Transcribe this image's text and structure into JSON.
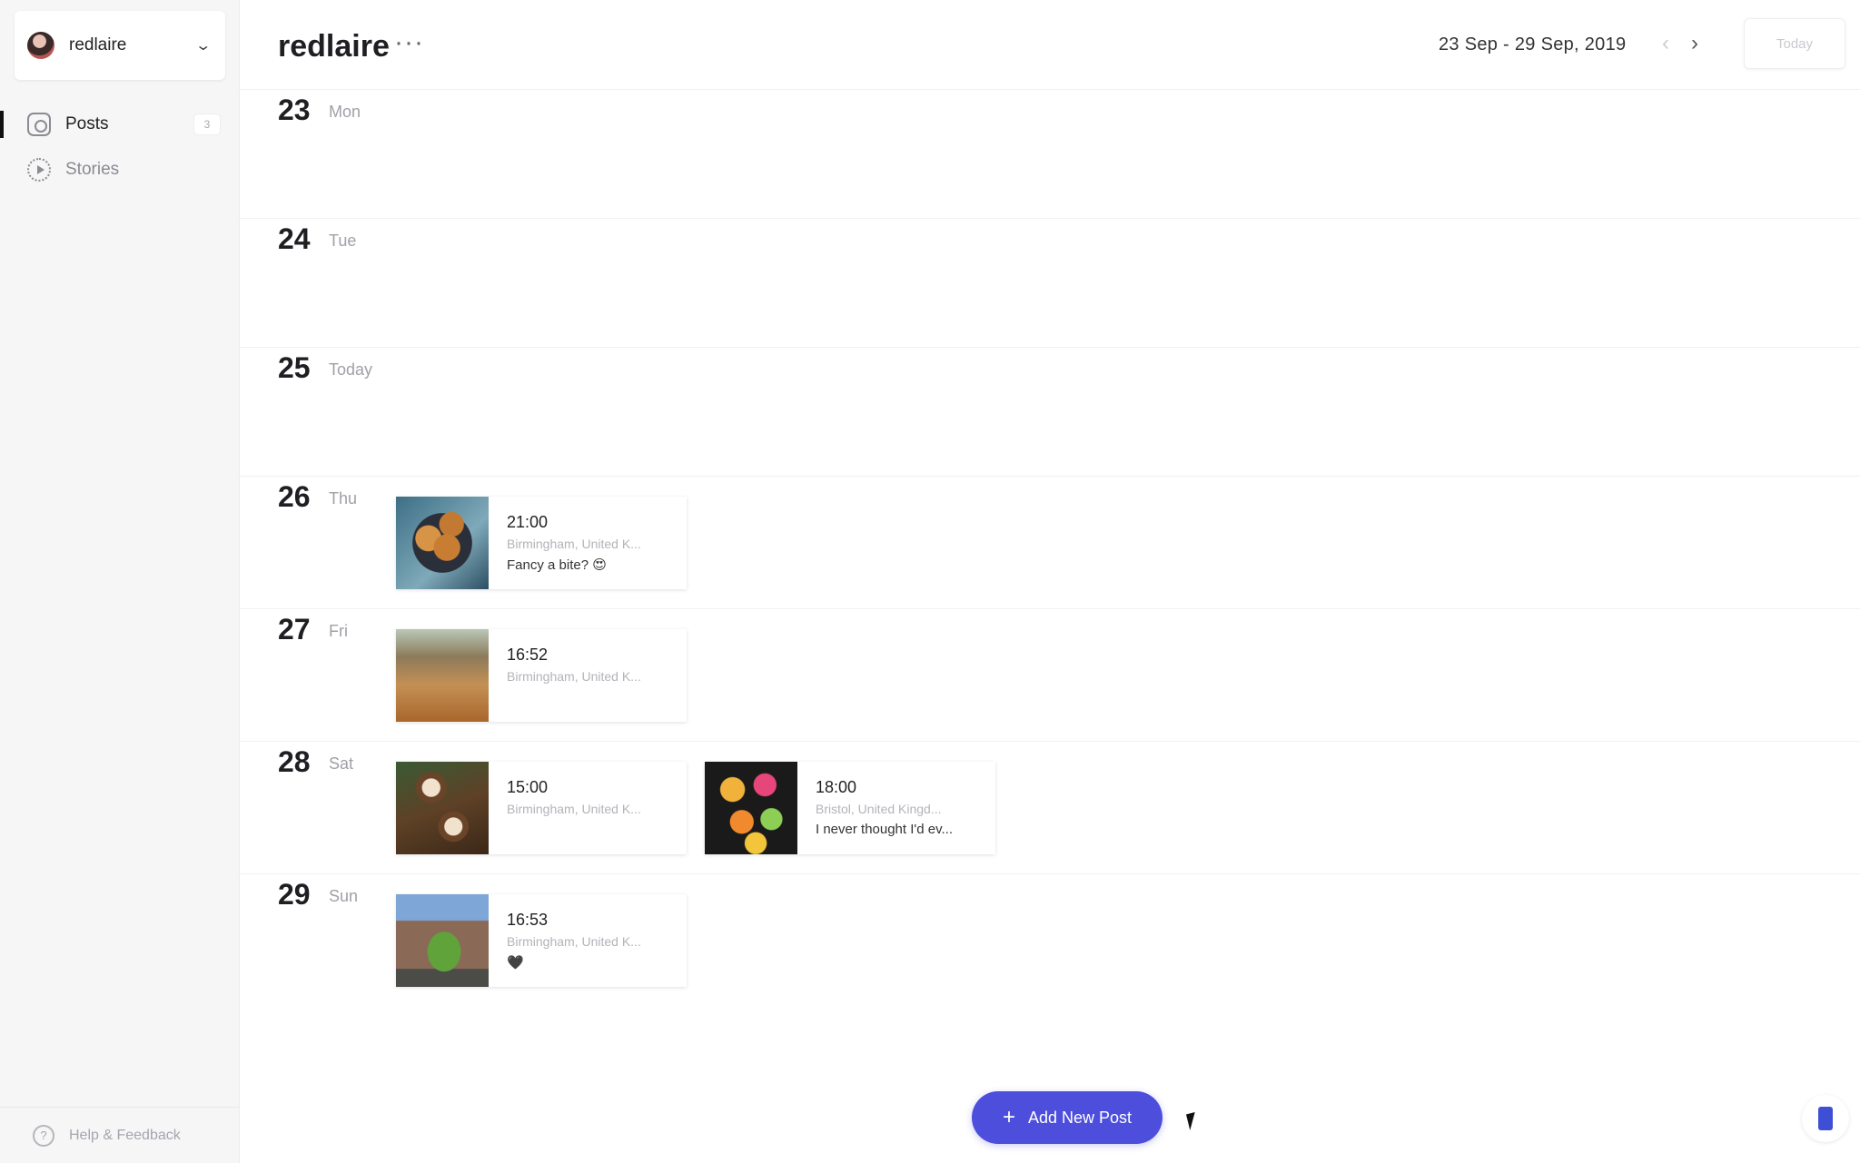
{
  "sidebar": {
    "account_name": "redlaire",
    "nav": [
      {
        "label": "Posts",
        "count": "3"
      },
      {
        "label": "Stories"
      }
    ],
    "help_label": "Help & Feedback"
  },
  "header": {
    "title": "redlaire",
    "more": "···",
    "date_range": "23 Sep - 29 Sep, 2019",
    "prev": "‹",
    "next": "›",
    "today_label": "Today"
  },
  "days": [
    {
      "num": "23",
      "name": "Mon"
    },
    {
      "num": "24",
      "name": "Tue"
    },
    {
      "num": "25",
      "name": "Today"
    },
    {
      "num": "26",
      "name": "Thu"
    },
    {
      "num": "27",
      "name": "Fri"
    },
    {
      "num": "28",
      "name": "Sat"
    },
    {
      "num": "29",
      "name": "Sun"
    }
  ],
  "posts": {
    "thu": [
      {
        "time": "21:00",
        "location": "Birmingham, United K...",
        "caption": "Fancy a bite? 😍",
        "image": "cookies"
      }
    ],
    "fri": [
      {
        "time": "16:52",
        "location": "Birmingham, United K...",
        "caption": "",
        "image": "autumn-leaves"
      }
    ],
    "sat": [
      {
        "time": "15:00",
        "location": "Birmingham, United K...",
        "caption": "",
        "image": "coffee-cups"
      },
      {
        "time": "18:00",
        "location": "Bristol, United Kingd...",
        "caption": "I never thought I'd ev...",
        "image": "fruit-slices"
      }
    ],
    "sun": [
      {
        "time": "16:53",
        "location": "Birmingham, United K...",
        "caption": "🖤",
        "image": "tree-building"
      }
    ]
  },
  "actions": {
    "add_post_label": "Add New Post",
    "add_post_icon": "+"
  },
  "colors": {
    "accent": "#4d4fdc",
    "sidebar_bg": "#f6f6f7"
  },
  "icons": {
    "account": "avatar",
    "chevron": "chevron-down-icon",
    "posts": "camera-icon",
    "stories": "stories-icon",
    "help": "help-icon",
    "phone": "phone-icon"
  }
}
